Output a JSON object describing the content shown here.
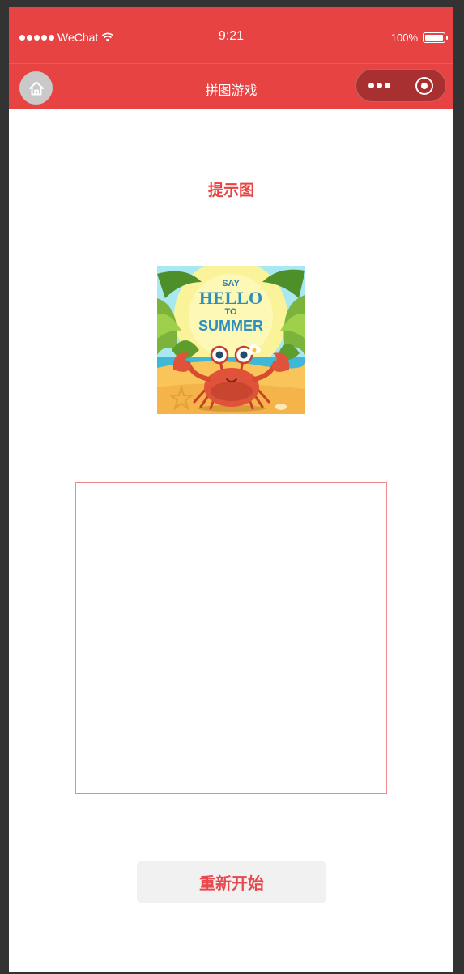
{
  "status_bar": {
    "carrier": "WeChat",
    "time": "9:21",
    "battery_percent": "100%",
    "battery_level": 1.0
  },
  "nav_bar": {
    "title": "拼图游戏",
    "home_icon": "home-icon",
    "more_icon": "more-dots-icon",
    "close_icon": "target-close-icon"
  },
  "hint": {
    "title": "提示图",
    "image_text": {
      "line1": "SAY",
      "line2": "HELLO",
      "line3": "TO",
      "line4": "SUMMER"
    }
  },
  "actions": {
    "restart_label": "重新开始"
  },
  "colors": {
    "brand_red": "#e84343",
    "button_bg": "#f1f1f1",
    "button_text": "#e8494e",
    "board_border": "#f08a8a"
  }
}
